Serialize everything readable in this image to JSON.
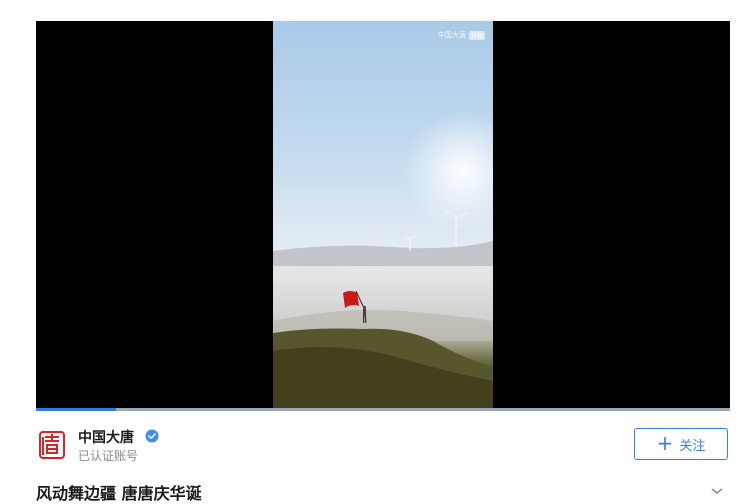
{
  "video": {
    "watermark_text": "中国大唐",
    "watermark_tag": "抖音",
    "progress": 0.115
  },
  "account": {
    "name": "中国大唐",
    "status": "已认证账号",
    "logo_color": "#d8232a",
    "verified_color": "#3e8ef7"
  },
  "follow": {
    "label": "关注",
    "accent": "#3e7be0"
  },
  "post": {
    "title": "风动舞边疆 唐唐庆华诞"
  }
}
